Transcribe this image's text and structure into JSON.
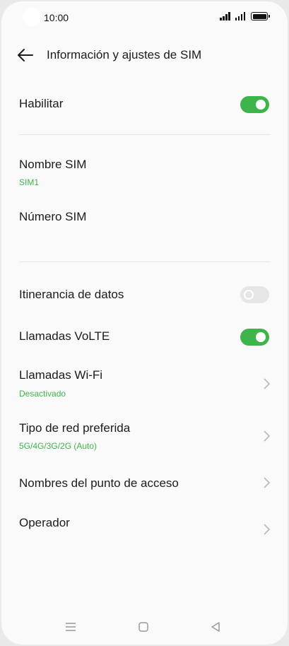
{
  "status_bar": {
    "time": "10:00",
    "icons": [
      "signal-icon",
      "signal-icon",
      "battery-icon"
    ]
  },
  "header": {
    "title": "Información y ajustes de SIM",
    "back_icon": "arrow-left-icon"
  },
  "settings": {
    "habilitar": {
      "label": "Habilitar",
      "enabled": true
    },
    "nombre_sim": {
      "label": "Nombre SIM",
      "value": "SIM1"
    },
    "numero_sim": {
      "label": "Número SIM"
    },
    "itinerancia": {
      "label": "Itinerancia de datos",
      "enabled": false
    },
    "volte": {
      "label": "Llamadas VoLTE",
      "enabled": true
    },
    "wifi_calls": {
      "label": "Llamadas Wi-Fi",
      "value": "Desactivado"
    },
    "red_preferida": {
      "label": "Tipo de red preferida",
      "value": "5G/4G/3G/2G (Auto)"
    },
    "apn": {
      "label": "Nombres del punto de acceso"
    },
    "operador": {
      "label": "Operador"
    }
  },
  "nav_bar": {
    "icons": [
      "menu-icon",
      "home-icon",
      "back-triangle-icon"
    ]
  },
  "colors": {
    "accent": "#3db54a",
    "toggle_off": "#e6e6e6",
    "background": "#fafafa"
  }
}
